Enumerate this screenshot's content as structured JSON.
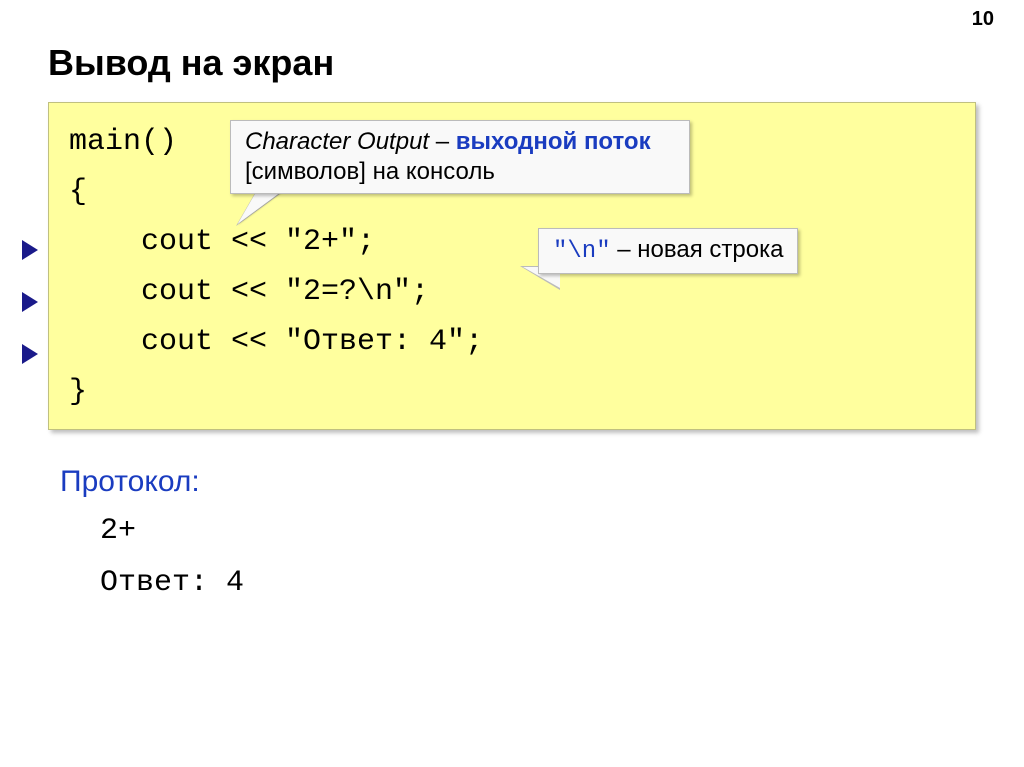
{
  "pageNumber": "10",
  "title": "Вывод на экран",
  "code": {
    "l1": "main()",
    "l2": "{",
    "l3": "    cout << \"2+\";",
    "l4": "    cout << \"2=?\\n\";",
    "l5": "    cout << \"Ответ: 4\";",
    "l6": "}"
  },
  "callout1": {
    "italic": "Character Output",
    "dash": " – ",
    "bold": "выходной поток",
    "rest": " [символов] на консоль"
  },
  "callout2": {
    "mono": "\"\\n\"",
    "dash": " – ",
    "rest": "новая строка"
  },
  "protocol": {
    "label": "Протокол:",
    "line1": "2+",
    "line2": "Ответ: 4"
  }
}
